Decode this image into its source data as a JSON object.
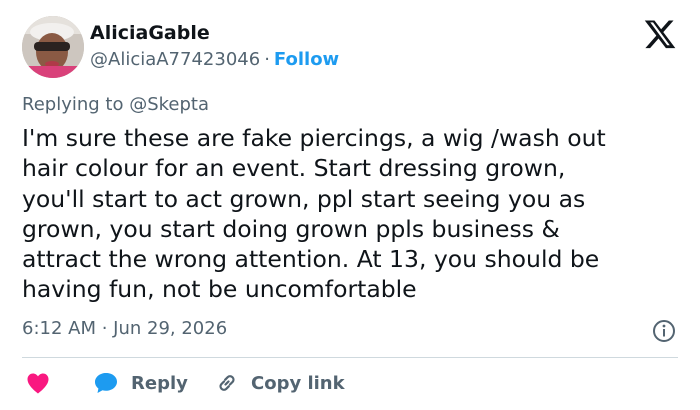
{
  "author": {
    "display_name": "AliciaGable",
    "handle": "@AliciaA77423046",
    "separator": "·",
    "follow_label": "Follow"
  },
  "reply_context": {
    "prefix": "Replying to",
    "mention": "@Skepta"
  },
  "body": {
    "lines": [
      "I'm sure these are fake piercings, a wig /wash out",
      "hair colour for an event. Start dressing grown,",
      "you'll start to act grown,  ppl start seeing you as",
      "grown,  you start doing grown ppls business &",
      "attract the wrong attention. At 13, you should be",
      "having fun,  not be uncomfortable"
    ]
  },
  "meta": {
    "timestamp": "6:12 AM · Jun 29, 2026"
  },
  "actions": {
    "reply_label": "Reply",
    "copy_link_label": "Copy link"
  },
  "icons": {
    "logo": "x-logo-icon",
    "like": "heart-icon",
    "reply": "speech-bubble-icon",
    "copy": "link-icon",
    "info": "info-icon"
  },
  "colors": {
    "text": "#0f1419",
    "secondary": "#536471",
    "accent": "#1d9bf0",
    "like": "#f91880",
    "divider": "#cfd9de"
  }
}
